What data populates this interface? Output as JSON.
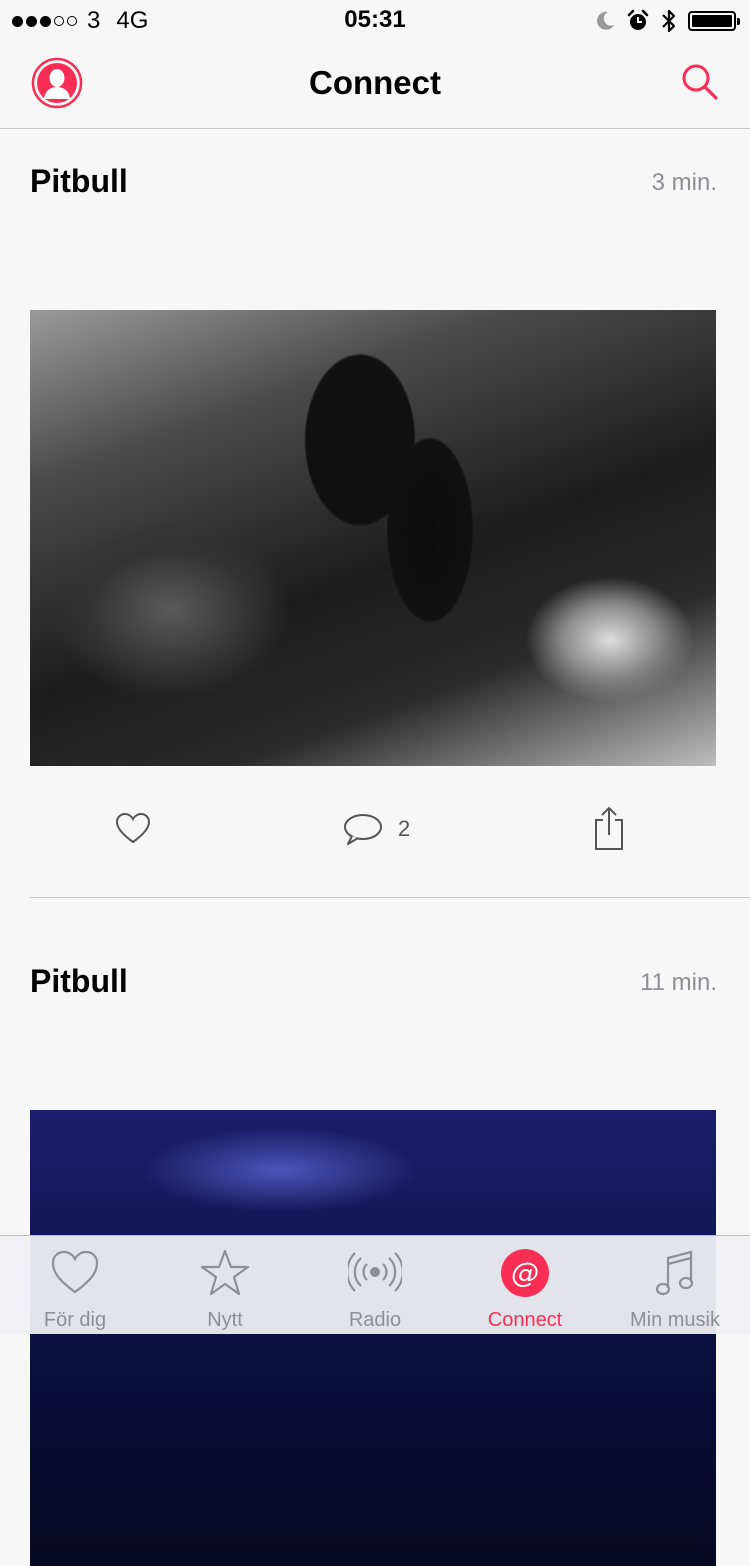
{
  "status_bar": {
    "signal_filled": 3,
    "signal_empty": 2,
    "carrier": "3",
    "network": "4G",
    "time": "05:31",
    "icons": [
      "moon-icon",
      "alarm-icon",
      "bluetooth-icon",
      "battery-icon"
    ],
    "battery_level": 1.0
  },
  "nav": {
    "title": "Connect",
    "left_icon": "profile-icon",
    "right_icon": "search-icon"
  },
  "colors": {
    "accent": "#fa2d55",
    "text": "#000000",
    "secondary_text": "#8e8e93",
    "background": "#f7f7f7"
  },
  "posts": [
    {
      "author": "Pitbull",
      "time": "3 min.",
      "comment_count": "2",
      "icons": [
        "heart-icon",
        "comment-icon",
        "share-icon"
      ]
    },
    {
      "author": "Pitbull",
      "time": "11 min."
    }
  ],
  "tabbar": {
    "tabs": [
      {
        "label": "För dig",
        "icon": "heart-icon",
        "active": false
      },
      {
        "label": "Nytt",
        "icon": "star-icon",
        "active": false
      },
      {
        "label": "Radio",
        "icon": "radio-icon",
        "active": false
      },
      {
        "label": "Connect",
        "icon": "at-sign-icon",
        "active": true
      },
      {
        "label": "Min musik",
        "icon": "music-note-icon",
        "active": false
      }
    ]
  }
}
